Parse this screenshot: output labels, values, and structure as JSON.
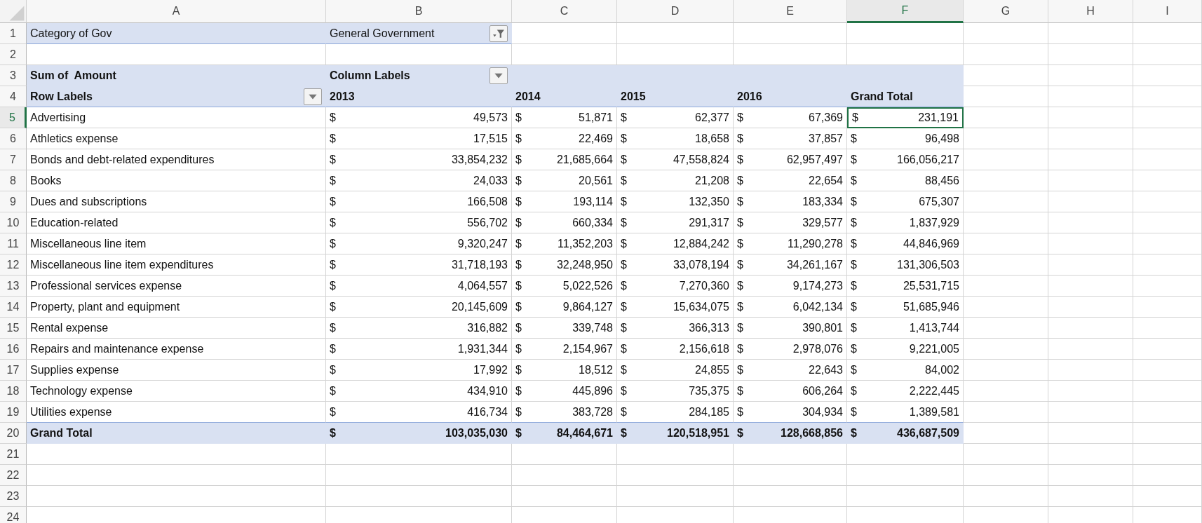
{
  "columns": [
    {
      "label": "A",
      "selected": false
    },
    {
      "label": "B",
      "selected": false
    },
    {
      "label": "C",
      "selected": false
    },
    {
      "label": "D",
      "selected": false
    },
    {
      "label": "E",
      "selected": false
    },
    {
      "label": "F",
      "selected": true
    },
    {
      "label": "G",
      "selected": false
    },
    {
      "label": "H",
      "selected": false
    },
    {
      "label": "I",
      "selected": false
    }
  ],
  "row_numbers": [
    {
      "label": "1",
      "selected": false
    },
    {
      "label": "2",
      "selected": false
    },
    {
      "label": "3",
      "selected": false
    },
    {
      "label": "4",
      "selected": false
    },
    {
      "label": "5",
      "selected": true
    },
    {
      "label": "6",
      "selected": false
    },
    {
      "label": "7",
      "selected": false
    },
    {
      "label": "8",
      "selected": false
    },
    {
      "label": "9",
      "selected": false
    },
    {
      "label": "10",
      "selected": false
    },
    {
      "label": "11",
      "selected": false
    },
    {
      "label": "12",
      "selected": false
    },
    {
      "label": "13",
      "selected": false
    },
    {
      "label": "14",
      "selected": false
    },
    {
      "label": "15",
      "selected": false
    },
    {
      "label": "16",
      "selected": false
    },
    {
      "label": "17",
      "selected": false
    },
    {
      "label": "18",
      "selected": false
    },
    {
      "label": "19",
      "selected": false
    },
    {
      "label": "20",
      "selected": false
    },
    {
      "label": "21",
      "selected": false
    },
    {
      "label": "22",
      "selected": false
    },
    {
      "label": "23",
      "selected": false
    },
    {
      "label": "24",
      "selected": false
    }
  ],
  "filter": {
    "label": "Category of Gov",
    "value": "General Government"
  },
  "pivot": {
    "value_label": "Sum of  Amount",
    "column_labels": "Column Labels",
    "row_labels": "Row Labels",
    "years": [
      "2013",
      "2014",
      "2015",
      "2016"
    ],
    "grand_total_header": "Grand Total",
    "rows": [
      {
        "label": "Advertising",
        "cells": [
          [
            "$",
            "49,573"
          ],
          [
            "$",
            "51,871"
          ],
          [
            "$",
            "62,377"
          ],
          [
            "$",
            "67,369"
          ],
          [
            "$",
            "231,191"
          ]
        ]
      },
      {
        "label": "Athletics expense",
        "cells": [
          [
            "$",
            "17,515"
          ],
          [
            "$",
            "22,469"
          ],
          [
            "$",
            "18,658"
          ],
          [
            "$",
            "37,857"
          ],
          [
            "$",
            "96,498"
          ]
        ]
      },
      {
        "label": "Bonds and debt-related expenditures",
        "cells": [
          [
            "$",
            "33,854,232"
          ],
          [
            "$",
            "21,685,664"
          ],
          [
            "$",
            "47,558,824"
          ],
          [
            "$",
            "62,957,497"
          ],
          [
            "$",
            "166,056,217"
          ]
        ]
      },
      {
        "label": "Books",
        "cells": [
          [
            "$",
            "24,033"
          ],
          [
            "$",
            "20,561"
          ],
          [
            "$",
            "21,208"
          ],
          [
            "$",
            "22,654"
          ],
          [
            "$",
            "88,456"
          ]
        ]
      },
      {
        "label": "Dues and subscriptions",
        "cells": [
          [
            "$",
            "166,508"
          ],
          [
            "$",
            "193,114"
          ],
          [
            "$",
            "132,350"
          ],
          [
            "$",
            "183,334"
          ],
          [
            "$",
            "675,307"
          ]
        ]
      },
      {
        "label": "Education-related",
        "cells": [
          [
            "$",
            "556,702"
          ],
          [
            "$",
            "660,334"
          ],
          [
            "$",
            "291,317"
          ],
          [
            "$",
            "329,577"
          ],
          [
            "$",
            "1,837,929"
          ]
        ]
      },
      {
        "label": "Miscellaneous line item",
        "cells": [
          [
            "$",
            "9,320,247"
          ],
          [
            "$",
            "11,352,203"
          ],
          [
            "$",
            "12,884,242"
          ],
          [
            "$",
            "11,290,278"
          ],
          [
            "$",
            "44,846,969"
          ]
        ]
      },
      {
        "label": "Miscellaneous line item expenditures",
        "cells": [
          [
            "$",
            "31,718,193"
          ],
          [
            "$",
            "32,248,950"
          ],
          [
            "$",
            "33,078,194"
          ],
          [
            "$",
            "34,261,167"
          ],
          [
            "$",
            "131,306,503"
          ]
        ]
      },
      {
        "label": "Professional services expense",
        "cells": [
          [
            "$",
            "4,064,557"
          ],
          [
            "$",
            "5,022,526"
          ],
          [
            "$",
            "7,270,360"
          ],
          [
            "$",
            "9,174,273"
          ],
          [
            "$",
            "25,531,715"
          ]
        ]
      },
      {
        "label": "Property, plant and equipment",
        "cells": [
          [
            "$",
            "20,145,609"
          ],
          [
            "$",
            "9,864,127"
          ],
          [
            "$",
            "15,634,075"
          ],
          [
            "$",
            "6,042,134"
          ],
          [
            "$",
            "51,685,946"
          ]
        ]
      },
      {
        "label": "Rental expense",
        "cells": [
          [
            "$",
            "316,882"
          ],
          [
            "$",
            "339,748"
          ],
          [
            "$",
            "366,313"
          ],
          [
            "$",
            "390,801"
          ],
          [
            "$",
            "1,413,744"
          ]
        ]
      },
      {
        "label": "Repairs and maintenance expense",
        "cells": [
          [
            "$",
            "1,931,344"
          ],
          [
            "$",
            "2,154,967"
          ],
          [
            "$",
            "2,156,618"
          ],
          [
            "$",
            "2,978,076"
          ],
          [
            "$",
            "9,221,005"
          ]
        ]
      },
      {
        "label": "Supplies expense",
        "cells": [
          [
            "$",
            "17,992"
          ],
          [
            "$",
            "18,512"
          ],
          [
            "$",
            "24,855"
          ],
          [
            "$",
            "22,643"
          ],
          [
            "$",
            "84,002"
          ]
        ]
      },
      {
        "label": "Technology expense",
        "cells": [
          [
            "$",
            "434,910"
          ],
          [
            "$",
            "445,896"
          ],
          [
            "$",
            "735,375"
          ],
          [
            "$",
            "606,264"
          ],
          [
            "$",
            "2,222,445"
          ]
        ]
      },
      {
        "label": "Utilities expense",
        "cells": [
          [
            "$",
            "416,734"
          ],
          [
            "$",
            "383,728"
          ],
          [
            "$",
            "284,185"
          ],
          [
            "$",
            "304,934"
          ],
          [
            "$",
            "1,389,581"
          ]
        ]
      }
    ],
    "grand_total": {
      "label": "Grand Total",
      "cells": [
        [
          "$",
          "103,035,030"
        ],
        [
          "$",
          "84,464,671"
        ],
        [
          "$",
          "120,518,951"
        ],
        [
          "$",
          "128,668,856"
        ],
        [
          "$",
          "436,687,509"
        ]
      ]
    }
  }
}
